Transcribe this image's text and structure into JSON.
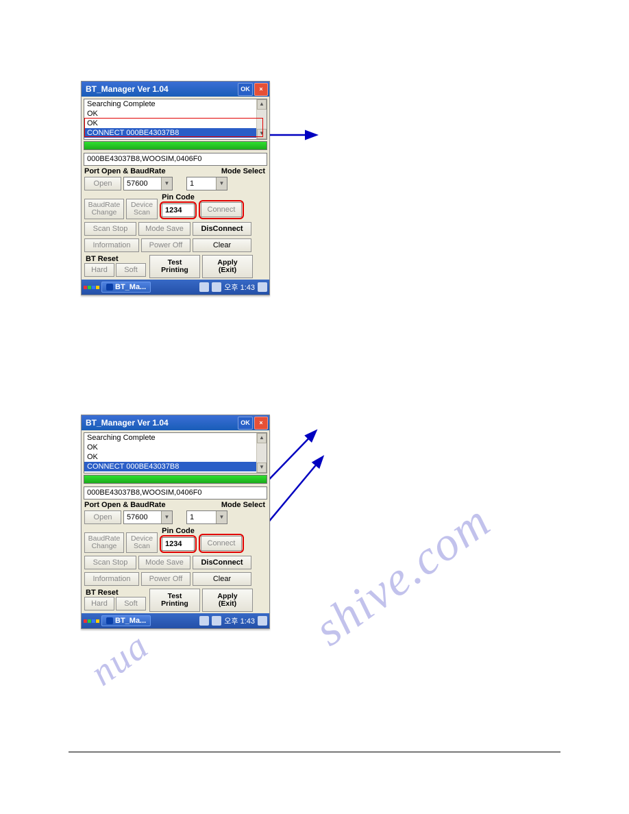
{
  "watermark": "shive.com",
  "window": {
    "title": "BT_Manager Ver 1.04",
    "ok": "OK",
    "close": "×",
    "list": {
      "line1": "Searching Complete",
      "line2": "OK",
      "line3": "OK",
      "selected": "CONNECT 000BE43037B8"
    },
    "device_info": "000BE43037B8,WOOSIM,0406F0",
    "label_port": "Port Open & BaudRate",
    "label_mode": "Mode Select",
    "open_btn": "Open",
    "baud": "57600",
    "mode": "1",
    "baudrate_change": "BaudRate\nChange",
    "device_scan": "Device\nScan",
    "pin_code_label": "Pin Code",
    "pin_value": "1234",
    "connect": "Connect",
    "scan_stop": "Scan Stop",
    "mode_save": "Mode Save",
    "disconnect": "DisConnect",
    "information": "Information",
    "power_off": "Power Off",
    "clear": "Clear",
    "bt_reset": "BT Reset",
    "hard": "Hard",
    "soft": "Soft",
    "test_printing": "Test\nPrinting",
    "apply_exit": "Apply\n(Exit)",
    "taskbar_app": "BT_Ma...",
    "clock": "오후 1:43"
  }
}
